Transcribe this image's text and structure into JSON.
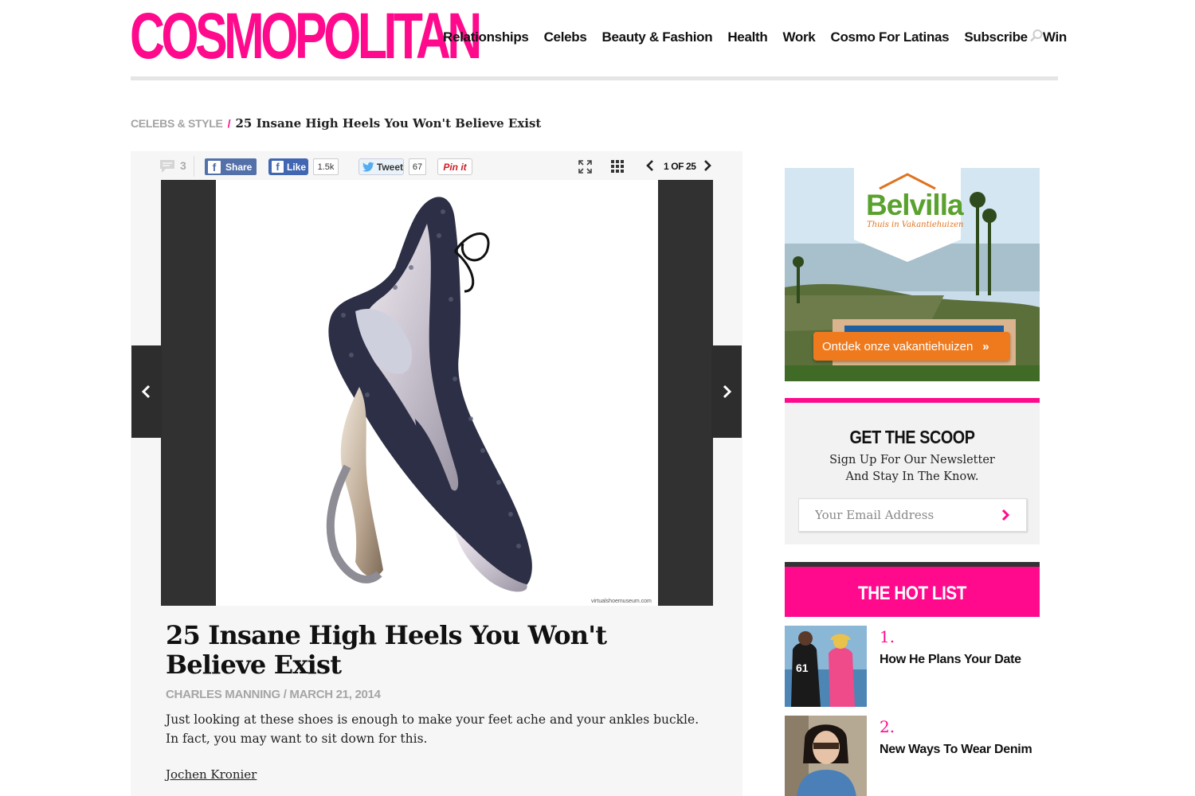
{
  "header": {
    "logo": "COSMOPOLITAN",
    "nav": [
      "Relationships",
      "Celebs",
      "Beauty & Fashion",
      "Health",
      "Work",
      "Cosmo For Latinas",
      "Subscribe",
      "Win"
    ],
    "brand_color": "#ff0a8c"
  },
  "breadcrumb": {
    "section": "CELEBS & STYLE",
    "separator": "/",
    "title": "25 Insane High Heels You Won't Believe Exist"
  },
  "gallery": {
    "comment_count": "3",
    "fb_share_label": "Share",
    "fb_like_label": "Like",
    "fb_like_count": "1.5k",
    "tweet_label": "Tweet",
    "tweet_count": "67",
    "pin_label": "Pin it",
    "slide_counter": "1 OF 25",
    "watermark": "virtualshoemuseum.com"
  },
  "article": {
    "title": "25 Insane High Heels You Won't Believe Exist",
    "byline": "CHARLES MANNING / MARCH 21, 2014",
    "dek": "Just looking at these shoes is enough to make your feet ache and your ankles buckle. In fact, you may want to sit down for this.",
    "credit": "Jochen Kronier"
  },
  "ad": {
    "brand": "Belvilla",
    "tagline": "Thuis in Vakantiehuizen",
    "cta": "Ontdek onze vakantiehuizen"
  },
  "newsletter": {
    "heading": "GET THE SCOOP",
    "subtext": "Sign Up For Our Newsletter And Stay In The Know.",
    "placeholder": "Your Email Address"
  },
  "hotlist": {
    "heading": "THE HOT LIST",
    "items": [
      {
        "rank": "1.",
        "title": "How He Plans Your Date"
      },
      {
        "rank": "2.",
        "title": "New Ways To Wear Denim"
      }
    ]
  }
}
